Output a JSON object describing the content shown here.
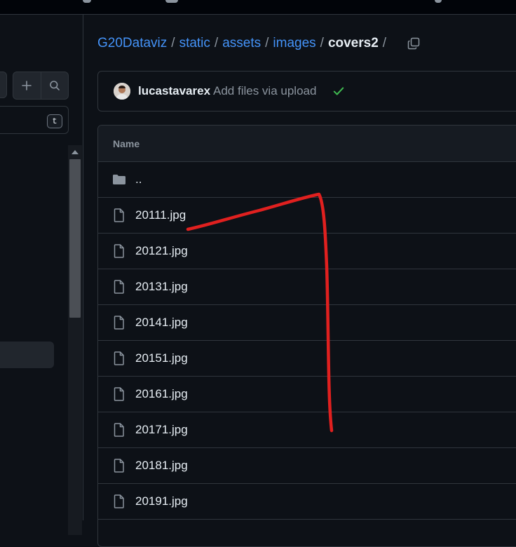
{
  "breadcrumb": {
    "items": [
      "G20Dataviz",
      "static",
      "assets",
      "images"
    ],
    "current": "covers2",
    "separator": "/"
  },
  "sidebar": {
    "filter_shortcut": "t"
  },
  "commit": {
    "author": "lucastavarex",
    "message": "Add files via upload",
    "status": "success"
  },
  "table": {
    "header": "Name",
    "parent_dir": "..",
    "files": [
      "20111.jpg",
      "20121.jpg",
      "20131.jpg",
      "20141.jpg",
      "20151.jpg",
      "20161.jpg",
      "20171.jpg",
      "20181.jpg",
      "20191.jpg"
    ]
  },
  "colors": {
    "link": "#4493f8",
    "success": "#3fb950",
    "annotation": "#e0201f"
  },
  "icons": [
    "plus-icon",
    "search-icon",
    "copy-icon",
    "check-icon",
    "folder-icon",
    "file-icon",
    "scroll-up-arrow-icon"
  ]
}
